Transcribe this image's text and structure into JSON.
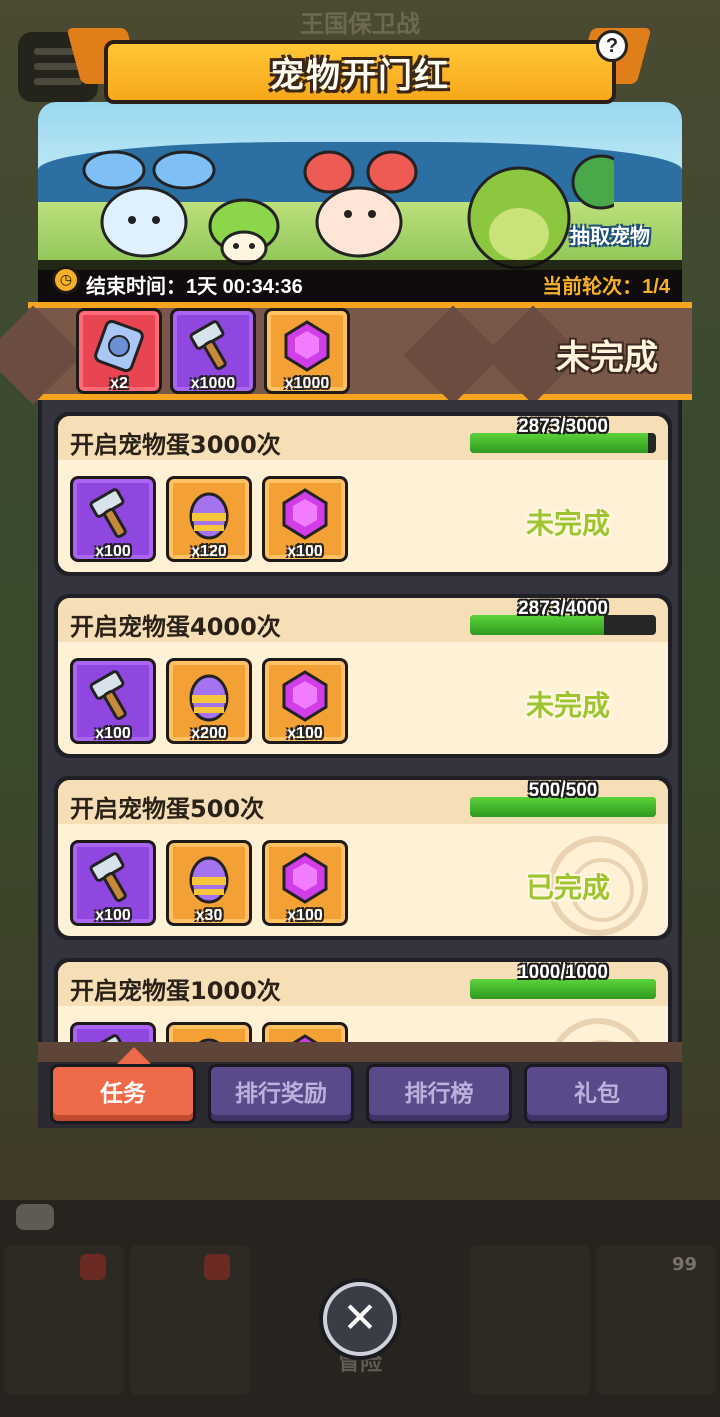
{
  "background": {
    "title": "王国保卫战",
    "adventure_label": "冒险",
    "badge_count": "99"
  },
  "modal": {
    "title": "宠物开门红",
    "help_icon": "question-mark-icon",
    "banner": {
      "draw_pet_label": "抽取宠物",
      "end_time": "结束时间：1天 00:34:36",
      "current_round": "当前轮次：1/4"
    },
    "grand_reward": {
      "items": [
        {
          "icon": "ticket-icon",
          "qty": "x2",
          "color": "red"
        },
        {
          "icon": "hammer-icon",
          "qty": "x1000",
          "color": "purple"
        },
        {
          "icon": "gem-icon",
          "qty": "x1000",
          "color": "orange"
        }
      ],
      "status": "未完成"
    },
    "tasks": [
      {
        "title": "开启宠物蛋3000次",
        "progress_text": "2873/3000",
        "progress_fraction": 0.958,
        "status": "未完成",
        "completed": false,
        "items": [
          {
            "icon": "hammer-icon",
            "qty": "x100",
            "color": "purple"
          },
          {
            "icon": "egg-icon",
            "qty": "x120",
            "color": "orange"
          },
          {
            "icon": "gem-icon",
            "qty": "x100",
            "color": "orange"
          }
        ]
      },
      {
        "title": "开启宠物蛋4000次",
        "progress_text": "2873/4000",
        "progress_fraction": 0.718,
        "status": "未完成",
        "completed": false,
        "items": [
          {
            "icon": "hammer-icon",
            "qty": "x100",
            "color": "purple"
          },
          {
            "icon": "egg-icon",
            "qty": "x200",
            "color": "orange"
          },
          {
            "icon": "gem-icon",
            "qty": "x100",
            "color": "orange"
          }
        ]
      },
      {
        "title": "开启宠物蛋500次",
        "progress_text": "500/500",
        "progress_fraction": 1.0,
        "status": "已完成",
        "completed": true,
        "items": [
          {
            "icon": "hammer-icon",
            "qty": "x100",
            "color": "purple"
          },
          {
            "icon": "egg-icon",
            "qty": "x30",
            "color": "orange"
          },
          {
            "icon": "gem-icon",
            "qty": "x100",
            "color": "orange"
          }
        ]
      },
      {
        "title": "开启宠物蛋1000次",
        "progress_text": "1000/1000",
        "progress_fraction": 1.0,
        "status": "",
        "completed": true,
        "items": [
          {
            "icon": "hammer-icon",
            "qty": "",
            "color": "purple"
          },
          {
            "icon": "egg-icon",
            "qty": "",
            "color": "orange"
          },
          {
            "icon": "gem-icon",
            "qty": "",
            "color": "orange"
          }
        ]
      }
    ],
    "tabs": [
      {
        "label": "任务",
        "active": true
      },
      {
        "label": "排行奖励",
        "active": false
      },
      {
        "label": "排行榜",
        "active": false
      },
      {
        "label": "礼包",
        "active": false
      }
    ]
  },
  "close_icon": "close-icon",
  "colors": {
    "ribbon": "#f6a81a",
    "progress": "#3fb72a",
    "status_incomplete": "#9ec531",
    "tab_active": "#ef6a48",
    "tab_inactive": "#5b4a8a"
  }
}
